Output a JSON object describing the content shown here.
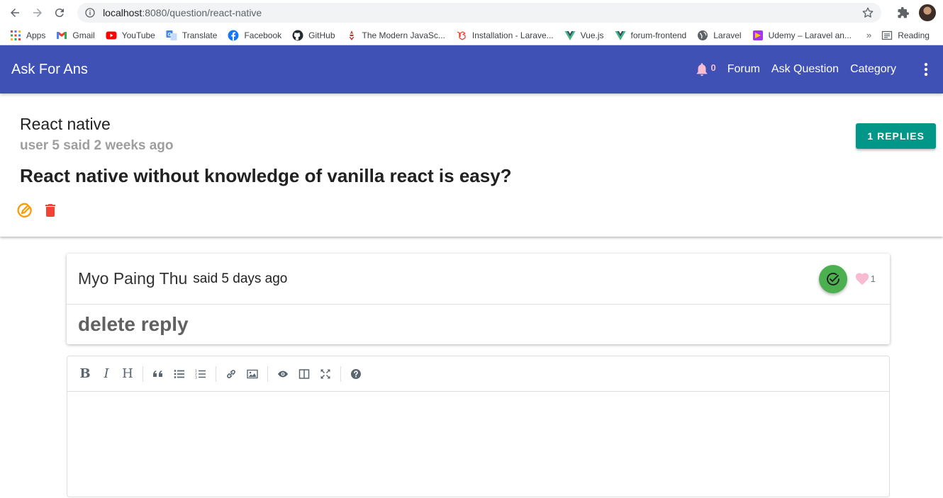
{
  "browser": {
    "url_host": "localhost",
    "url_path": ":8080/question/react-native",
    "bookmarks": [
      {
        "label": "Apps",
        "icon": "apps-grid-icon"
      },
      {
        "label": "Gmail",
        "icon": "gmail-icon"
      },
      {
        "label": "YouTube",
        "icon": "youtube-icon"
      },
      {
        "label": "Translate",
        "icon": "translate-icon"
      },
      {
        "label": "Facebook",
        "icon": "facebook-icon"
      },
      {
        "label": "GitHub",
        "icon": "github-icon"
      },
      {
        "label": "The Modern JavaSc...",
        "icon": "modern-js-icon"
      },
      {
        "label": "Installation - Larave...",
        "icon": "laravel-icon"
      },
      {
        "label": "Vue.js",
        "icon": "vue-icon"
      },
      {
        "label": "forum-frontend",
        "icon": "vue-icon"
      },
      {
        "label": "Laravel",
        "icon": "globe-icon"
      },
      {
        "label": "Udemy – Laravel an...",
        "icon": "udemy-icon"
      }
    ],
    "more_label": "»",
    "reading_label": "Reading"
  },
  "app": {
    "title": "Ask For Ans",
    "notification_count": "0",
    "nav": [
      "Forum",
      "Ask Question",
      "Category"
    ]
  },
  "question": {
    "title": "React native",
    "meta": "user 5 said 2 weeks ago",
    "body": "React native without knowledge of vanilla react is easy?",
    "replies_label": "1 REPLIES"
  },
  "reply": {
    "user": "Myo Paing Thu",
    "said": "said 5 days ago",
    "likes": "1",
    "body": "delete reply"
  },
  "colors": {
    "app_bar": "#3f51b5",
    "replies_button": "#009688",
    "accept_button": "#4caf50",
    "edit_icon": "#ff9800",
    "delete_icon": "#f44336",
    "like_heart": "#f8bbd0"
  }
}
